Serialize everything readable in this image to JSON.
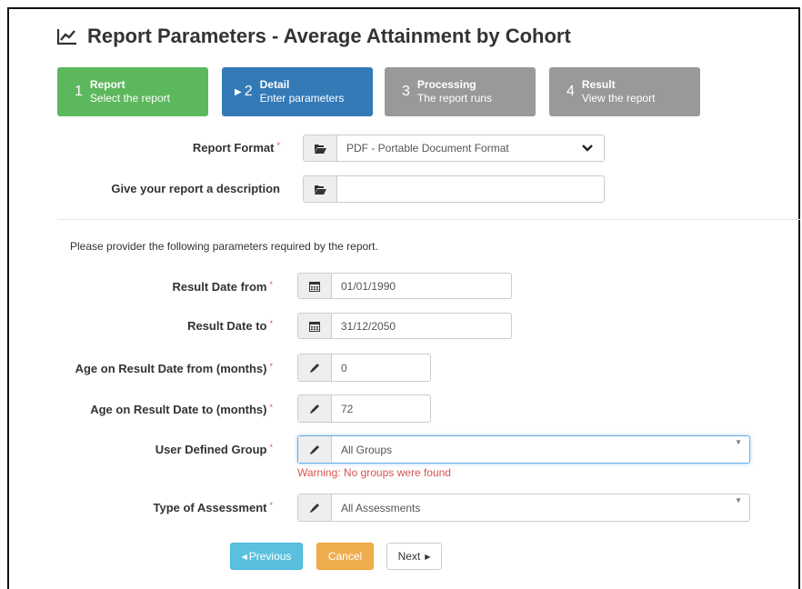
{
  "page": {
    "title": "Report Parameters - Average Attainment by Cohort",
    "title_icon": "line-chart-icon"
  },
  "steps": [
    {
      "num": "1",
      "title": "Report",
      "subtitle": "Select the report",
      "color": "#5cb85c",
      "state": "done"
    },
    {
      "num": "2",
      "title": "Detail",
      "subtitle": "Enter parameters",
      "color": "#337ab7",
      "state": "active"
    },
    {
      "num": "3",
      "title": "Processing",
      "subtitle": "The report runs",
      "color": "#999999",
      "state": "pending"
    },
    {
      "num": "4",
      "title": "Result",
      "subtitle": "View the report",
      "color": "#999999",
      "state": "pending"
    }
  ],
  "format": {
    "report_format_label": "Report Format",
    "report_format_value": "PDF - Portable Document Format",
    "description_label": "Give your report a description",
    "description_value": ""
  },
  "params": {
    "intro": "Please provider the following parameters required by the report.",
    "result_date_from_label": "Result Date from",
    "result_date_from_value": "01/01/1990",
    "result_date_to_label": "Result Date to",
    "result_date_to_value": "31/12/2050",
    "age_from_label": "Age on Result Date from (months)",
    "age_from_value": "0",
    "age_to_label": "Age on Result Date to (months)",
    "age_to_value": "72",
    "group_label": "User Defined Group",
    "group_value": "All Groups",
    "group_warning": "Warning: No groups were found",
    "assessment_label": "Type of Assessment",
    "assessment_value": "All Assessments",
    "required_marker": "*"
  },
  "buttons": {
    "previous": "Previous",
    "cancel": "Cancel",
    "next": "Next"
  },
  "colors": {
    "required": "#d9534f",
    "warning": "#d9534f",
    "step_done": "#5cb85c",
    "step_active": "#337ab7",
    "step_pending": "#999999",
    "previous_button": "#5bc0de",
    "cancel_button": "#f0ad4e"
  }
}
